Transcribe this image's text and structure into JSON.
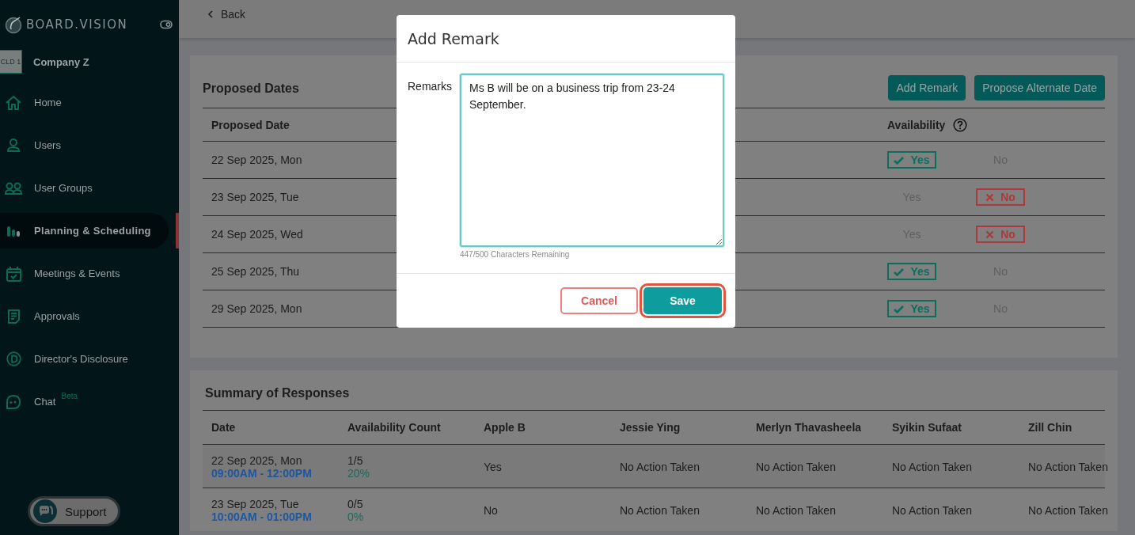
{
  "sidebar": {
    "logo": "BOARD.VISION",
    "company": {
      "avatar": "CLD 1",
      "name": "Company Z"
    },
    "items": [
      {
        "label": "Home",
        "selected": false
      },
      {
        "label": "Users",
        "selected": false
      },
      {
        "label": "User Groups",
        "selected": false
      },
      {
        "label": "Planning & Scheduling",
        "selected": true
      },
      {
        "label": "Meetings & Events",
        "selected": false
      },
      {
        "label": "Approvals",
        "selected": false
      },
      {
        "label": "Director's Disclosure",
        "selected": false
      },
      {
        "label": "Chat",
        "badge": "Beta",
        "selected": false
      }
    ],
    "support": "Support"
  },
  "top_bar": {
    "back": "Back"
  },
  "proposed_dates": {
    "title": "Proposed Dates",
    "buttons": [
      "Add Remark",
      "Propose Alternate Date"
    ],
    "columns": [
      "Proposed Date",
      "Availability"
    ],
    "rows": [
      {
        "date": "22 Sep 2025, Mon",
        "options": [
          {
            "kind": "yes",
            "label": "Yes",
            "selected": true
          },
          {
            "kind": "no",
            "label": "No",
            "selected": false
          }
        ]
      },
      {
        "date": "23 Sep 2025, Tue",
        "options": [
          {
            "kind": "yes",
            "label": "Yes",
            "selected": false
          },
          {
            "kind": "no",
            "label": "No",
            "selected": true
          }
        ]
      },
      {
        "date": "24 Sep 2025, Wed",
        "options": [
          {
            "kind": "yes",
            "label": "Yes",
            "selected": false
          },
          {
            "kind": "no",
            "label": "No",
            "selected": true
          }
        ]
      },
      {
        "date": "25 Sep 2025, Thu",
        "options": [
          {
            "kind": "yes",
            "label": "Yes",
            "selected": true
          },
          {
            "kind": "no",
            "label": "No",
            "selected": false
          }
        ]
      },
      {
        "date": "29 Sep 2025, Mon",
        "options": [
          {
            "kind": "yes",
            "label": "Yes",
            "selected": true
          },
          {
            "kind": "no",
            "label": "No",
            "selected": false
          }
        ]
      }
    ]
  },
  "summary": {
    "title": "Summary of Responses",
    "columns": [
      "Date",
      "Availability Count",
      "Apple B",
      "Jessie Ying",
      "Merlyn Thavasheela",
      "Syikin Sufaat",
      "Zill Chin"
    ],
    "rows": [
      {
        "date": "22 Sep 2025, Mon",
        "time": "09:00AM - 12:00PM",
        "count": "1/5",
        "percent": "20%",
        "responses": [
          "Yes",
          "No Action Taken",
          "No Action Taken",
          "No Action Taken",
          "No Action Taken"
        ]
      },
      {
        "date": "23 Sep 2025, Tue",
        "time": "10:00AM - 01:00PM",
        "count": "0/5",
        "percent": "0%",
        "responses": [
          "No",
          "No Action Taken",
          "No Action Taken",
          "No Action Taken",
          "No Action Taken"
        ]
      }
    ]
  },
  "modal": {
    "title": "Add Remark",
    "label": "Remarks",
    "value": "Ms B will be on a business trip from 23-24 September.",
    "counter": "447/500 Characters Remaining",
    "buttons": [
      {
        "kind": "cancel",
        "label": "Cancel",
        "highlighted": false
      },
      {
        "kind": "save",
        "label": "Save",
        "highlighted": true
      }
    ]
  }
}
